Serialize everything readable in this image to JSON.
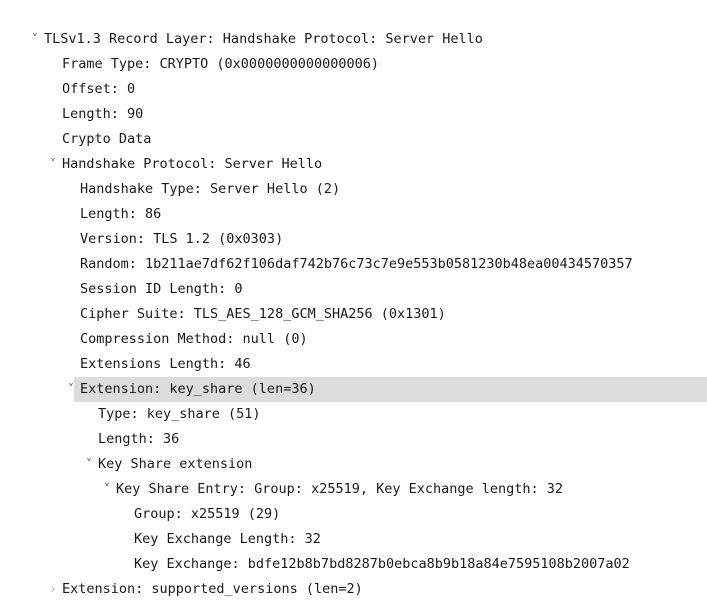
{
  "view": {
    "app": "wireshark-packet-details",
    "pane_name": "packet-detail-tree",
    "background_color": "#ffffff",
    "text_color": "#1a1a1a",
    "selection_color": "#dcdcdc"
  },
  "icons": {
    "expanded": "˅",
    "collapsed": "›"
  },
  "tree": [
    {
      "id": "tls-record-layer",
      "name": "tree-row-tls-record-layer",
      "text": "TLSv1.3 Record Layer: Handshake Protocol: Server Hello",
      "depth": 0,
      "state": "expanded",
      "selected": false
    },
    {
      "id": "frame-type",
      "name": "tree-row-frame-type",
      "text": "Frame Type: CRYPTO (0x0000000000000006)",
      "depth": 1,
      "state": "leaf",
      "selected": false
    },
    {
      "id": "offset",
      "name": "tree-row-offset",
      "text": "Offset: 0",
      "depth": 1,
      "state": "leaf",
      "selected": false
    },
    {
      "id": "length-90",
      "name": "tree-row-length",
      "text": "Length: 90",
      "depth": 1,
      "state": "leaf",
      "selected": false
    },
    {
      "id": "crypto-data",
      "name": "tree-row-crypto-data",
      "text": "Crypto Data",
      "depth": 1,
      "state": "leaf",
      "selected": false
    },
    {
      "id": "handshake-protocol",
      "name": "tree-row-handshake-protocol",
      "text": "Handshake Protocol: Server Hello",
      "depth": 1,
      "state": "expanded",
      "selected": false
    },
    {
      "id": "handshake-type",
      "name": "tree-row-handshake-type",
      "text": "Handshake Type: Server Hello (2)",
      "depth": 2,
      "state": "leaf",
      "selected": false
    },
    {
      "id": "length-86",
      "name": "tree-row-handshake-length",
      "text": "Length: 86",
      "depth": 2,
      "state": "leaf",
      "selected": false
    },
    {
      "id": "version",
      "name": "tree-row-version",
      "text": "Version: TLS 1.2 (0x0303)",
      "depth": 2,
      "state": "leaf",
      "selected": false
    },
    {
      "id": "random",
      "name": "tree-row-random",
      "text": "Random: 1b211ae7df62f106daf742b76c73c7e9e553b0581230b48ea00434570357",
      "depth": 2,
      "state": "leaf",
      "selected": false,
      "truncated": true
    },
    {
      "id": "session-id-length",
      "name": "tree-row-session-id-length",
      "text": "Session ID Length: 0",
      "depth": 2,
      "state": "leaf",
      "selected": false
    },
    {
      "id": "cipher-suite",
      "name": "tree-row-cipher-suite",
      "text": "Cipher Suite: TLS_AES_128_GCM_SHA256 (0x1301)",
      "depth": 2,
      "state": "leaf",
      "selected": false
    },
    {
      "id": "compression-method",
      "name": "tree-row-compression-method",
      "text": "Compression Method: null (0)",
      "depth": 2,
      "state": "leaf",
      "selected": false
    },
    {
      "id": "extensions-length",
      "name": "tree-row-extensions-length",
      "text": "Extensions Length: 46",
      "depth": 2,
      "state": "leaf",
      "selected": false
    },
    {
      "id": "extension-key-share",
      "name": "tree-row-extension-key-share",
      "text": "Extension: key_share (len=36)",
      "depth": 2,
      "state": "expanded",
      "selected": true
    },
    {
      "id": "type-key-share",
      "name": "tree-row-type-key-share",
      "text": "Type: key_share (51)",
      "depth": 3,
      "state": "leaf",
      "selected": false
    },
    {
      "id": "length-36",
      "name": "tree-row-extension-length",
      "text": "Length: 36",
      "depth": 3,
      "state": "leaf",
      "selected": false
    },
    {
      "id": "key-share-extension",
      "name": "tree-row-key-share-extension",
      "text": "Key Share extension",
      "depth": 3,
      "state": "expanded",
      "selected": false
    },
    {
      "id": "key-share-entry",
      "name": "tree-row-key-share-entry",
      "text": "Key Share Entry: Group: x25519, Key Exchange length: 32",
      "depth": 4,
      "state": "expanded",
      "selected": false
    },
    {
      "id": "group",
      "name": "tree-row-group",
      "text": "Group: x25519 (29)",
      "depth": 5,
      "state": "leaf",
      "selected": false
    },
    {
      "id": "key-exchange-length",
      "name": "tree-row-key-exchange-length",
      "text": "Key Exchange Length: 32",
      "depth": 5,
      "state": "leaf",
      "selected": false
    },
    {
      "id": "key-exchange",
      "name": "tree-row-key-exchange",
      "text": "Key Exchange: bdfe12b8b7bd8287b0ebca8b9b18a84e7595108b2007a02",
      "depth": 5,
      "state": "leaf",
      "selected": false,
      "truncated": true
    },
    {
      "id": "extension-supported-versions",
      "name": "tree-row-extension-supported-versions",
      "text": "Extension: supported_versions (len=2)",
      "depth": 1,
      "state": "collapsed",
      "selected": false
    }
  ]
}
